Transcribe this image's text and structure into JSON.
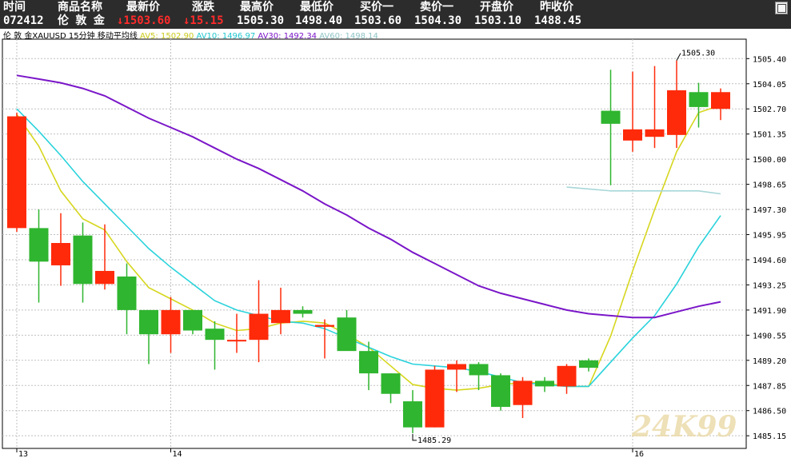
{
  "header": {
    "labels": [
      "时间",
      "商品名称",
      "最新价",
      "涨跌",
      "最高价",
      "最低价",
      "买价一",
      "卖价一",
      "开盘价",
      "昨收价"
    ],
    "values": {
      "time": "072412",
      "name": "伦 敦 金",
      "last": "↓1503.60",
      "change": "↓15.15",
      "high": "1505.30",
      "low": "1498.40",
      "bid": "1503.60",
      "ask": "1504.30",
      "open": "1503.10",
      "prev_close": "1488.45"
    }
  },
  "legend": {
    "title": "伦 敦 金XAUUSD 15分钟 移动平均线",
    "ma5": "AV5: 1502.90",
    "ma10": "AV10: 1496.97",
    "ma30": "AV30: 1492.34",
    "ma60": "AV60: 1498.14"
  },
  "colors": {
    "up": "#ff2a0a",
    "down": "#2fb52f",
    "ma5": "#d6d61e",
    "ma10": "#2ad3dc",
    "ma30": "#7a16c8",
    "ma60": "#a8d6d8",
    "grid": "#c0c0c0"
  },
  "chart_data": {
    "type": "candlestick",
    "ylim": [
      1484.9,
      1506.1
    ],
    "y_ticks": [
      "1505.40",
      "1504.05",
      "1502.70",
      "1501.35",
      "1500.00",
      "1498.65",
      "1497.30",
      "1495.95",
      "1494.60",
      "1493.25",
      "1491.90",
      "1490.55",
      "1489.20",
      "1487.85",
      "1486.50",
      "1485.15"
    ],
    "x_labels": [
      {
        "index": 0,
        "label": "13"
      },
      {
        "index": 7,
        "label": "14"
      },
      {
        "index": 28,
        "label": "16"
      }
    ],
    "candles": [
      {
        "o": 1496.3,
        "h": 1502.5,
        "l": 1496.1,
        "c": 1502.3
      },
      {
        "o": 1496.3,
        "h": 1497.3,
        "l": 1492.3,
        "c": 1494.5
      },
      {
        "o": 1494.3,
        "h": 1497.1,
        "l": 1493.2,
        "c": 1495.5
      },
      {
        "o": 1495.9,
        "h": 1496.6,
        "l": 1492.3,
        "c": 1493.3
      },
      {
        "o": 1493.3,
        "h": 1496.5,
        "l": 1493.0,
        "c": 1494.0
      },
      {
        "o": 1493.7,
        "h": 1494.4,
        "l": 1490.6,
        "c": 1491.9
      },
      {
        "o": 1491.9,
        "h": 1491.9,
        "l": 1489.0,
        "c": 1490.6
      },
      {
        "o": 1490.6,
        "h": 1492.6,
        "l": 1489.6,
        "c": 1491.9
      },
      {
        "o": 1491.9,
        "h": 1491.9,
        "l": 1490.6,
        "c": 1490.8
      },
      {
        "o": 1490.9,
        "h": 1491.3,
        "l": 1488.7,
        "c": 1490.3
      },
      {
        "o": 1490.3,
        "h": 1491.7,
        "l": 1489.6,
        "c": 1490.3
      },
      {
        "o": 1490.3,
        "h": 1493.5,
        "l": 1489.1,
        "c": 1491.7
      },
      {
        "o": 1491.2,
        "h": 1493.1,
        "l": 1490.6,
        "c": 1491.9
      },
      {
        "o": 1491.9,
        "h": 1492.1,
        "l": 1491.5,
        "c": 1491.7
      },
      {
        "o": 1491.0,
        "h": 1491.4,
        "l": 1489.3,
        "c": 1491.1
      },
      {
        "o": 1491.5,
        "h": 1491.9,
        "l": 1489.8,
        "c": 1489.7
      },
      {
        "o": 1489.7,
        "h": 1490.2,
        "l": 1487.6,
        "c": 1488.5
      },
      {
        "o": 1488.5,
        "h": 1488.5,
        "l": 1486.9,
        "c": 1487.4
      },
      {
        "o": 1487.0,
        "h": 1487.6,
        "l": 1485.29,
        "c": 1485.6
      },
      {
        "o": 1485.6,
        "h": 1488.9,
        "l": 1485.6,
        "c": 1488.7
      },
      {
        "o": 1488.7,
        "h": 1489.2,
        "l": 1487.5,
        "c": 1489.0
      },
      {
        "o": 1489.0,
        "h": 1489.1,
        "l": 1487.6,
        "c": 1488.4
      },
      {
        "o": 1488.4,
        "h": 1488.5,
        "l": 1486.5,
        "c": 1486.7
      },
      {
        "o": 1486.8,
        "h": 1488.3,
        "l": 1486.1,
        "c": 1488.1
      },
      {
        "o": 1488.1,
        "h": 1488.3,
        "l": 1487.5,
        "c": 1487.8
      },
      {
        "o": 1487.8,
        "h": 1489.0,
        "l": 1487.4,
        "c": 1488.9
      },
      {
        "o": 1489.2,
        "h": 1489.3,
        "l": 1488.6,
        "c": 1488.8
      },
      {
        "o": 1502.6,
        "h": 1504.8,
        "l": 1498.6,
        "c": 1501.9
      },
      {
        "o": 1501.0,
        "h": 1504.7,
        "l": 1500.4,
        "c": 1501.6
      },
      {
        "o": 1501.2,
        "h": 1505.0,
        "l": 1500.6,
        "c": 1501.6
      },
      {
        "o": 1501.3,
        "h": 1505.3,
        "l": 1500.6,
        "c": 1503.7
      },
      {
        "o": 1503.6,
        "h": 1504.1,
        "l": 1501.7,
        "c": 1502.8
      },
      {
        "o": 1502.7,
        "h": 1503.8,
        "l": 1502.1,
        "c": 1503.6
      }
    ],
    "series": [
      {
        "name": "AV5",
        "values": [
          1502.4,
          1500.7,
          1498.3,
          1496.8,
          1496.2,
          1494.5,
          1493.1,
          1492.5,
          1491.9,
          1491.2,
          1490.8,
          1490.9,
          1491.2,
          1491.3,
          1491.2,
          1490.6,
          1489.9,
          1488.9,
          1487.9,
          1487.7,
          1487.6,
          1487.7,
          1487.9,
          1488.0,
          1488.0,
          1487.8,
          1487.8,
          1490.5,
          1494.0,
          1497.3,
          1500.4,
          1502.5,
          1502.9
        ]
      },
      {
        "name": "AV10",
        "values": [
          1502.7,
          1501.5,
          1500.2,
          1498.8,
          1497.6,
          1496.4,
          1495.2,
          1494.2,
          1493.3,
          1492.4,
          1491.9,
          1491.6,
          1491.3,
          1491.2,
          1490.9,
          1490.4,
          1489.9,
          1489.4,
          1489.0,
          1488.9,
          1488.8,
          1488.6,
          1488.3,
          1488.0,
          1487.9,
          1487.8,
          1487.8,
          1489.1,
          1490.4,
          1491.6,
          1493.3,
          1495.3,
          1496.97
        ]
      },
      {
        "name": "AV30",
        "values": [
          1504.5,
          1504.3,
          1504.1,
          1503.8,
          1503.4,
          1502.8,
          1502.2,
          1501.7,
          1501.2,
          1500.6,
          1500.0,
          1499.5,
          1498.9,
          1498.3,
          1497.6,
          1497.0,
          1496.3,
          1495.7,
          1495.0,
          1494.4,
          1493.8,
          1493.2,
          1492.8,
          1492.5,
          1492.2,
          1491.9,
          1491.7,
          1491.6,
          1491.5,
          1491.5,
          1491.8,
          1492.1,
          1492.34
        ]
      },
      {
        "name": "AV60",
        "values": [
          null,
          null,
          null,
          null,
          null,
          null,
          null,
          null,
          null,
          null,
          null,
          null,
          null,
          null,
          null,
          null,
          null,
          null,
          null,
          null,
          null,
          null,
          null,
          null,
          null,
          1498.5,
          1498.4,
          1498.3,
          1498.3,
          1498.3,
          1498.3,
          1498.3,
          1498.14
        ]
      }
    ],
    "annotations": [
      {
        "index": 18,
        "value": 1485.29,
        "text": "1485.29",
        "position": "below"
      },
      {
        "index": 30,
        "value": 1505.3,
        "text": "1505.30",
        "position": "above"
      }
    ],
    "watermark": "24K99"
  }
}
